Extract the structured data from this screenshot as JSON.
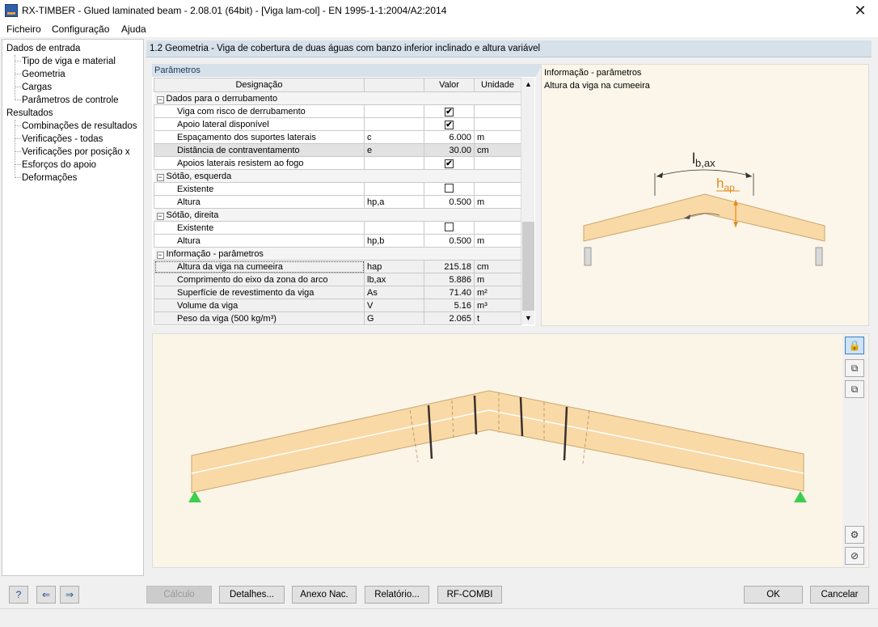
{
  "window": {
    "title": "RX-TIMBER - Glued laminated beam - 2.08.01 (64bit) - [Viga lam-col] - EN 1995-1-1:2004/A2:2014",
    "close_glyph": "✕"
  },
  "menu": [
    "Ficheiro",
    "Configuração",
    "Ajuda"
  ],
  "nav": {
    "group_input": "Dados de entrada",
    "input_items": [
      "Tipo de viga e material",
      "Geometria",
      "Cargas",
      "Parâmetros de controle"
    ],
    "group_results": "Resultados",
    "result_items": [
      "Combinações de resultados",
      "Verificações - todas",
      "Verificações por posição x",
      "Esforços do apoio",
      "Deformações"
    ]
  },
  "section": {
    "title": "1.2 Geometria  -  Viga de cobertura de duas águas com banzo inferior inclinado e altura variável"
  },
  "params": {
    "tab_label": "Parâmetros",
    "columns": [
      "Designação",
      "",
      "Valor",
      "Unidade"
    ],
    "groups": [
      {
        "label": "Dados para o derrubamento",
        "rows": [
          {
            "name": "Viga com risco de derrubamento",
            "sym": "",
            "value": "✔",
            "unit": "",
            "type": "check"
          },
          {
            "name": "Apoio lateral disponível",
            "sym": "",
            "value": "✔",
            "unit": "",
            "type": "check"
          },
          {
            "name": "Espaçamento dos suportes laterais",
            "sym": "c",
            "value": "6.000",
            "unit": "m",
            "type": "num"
          },
          {
            "name": "Distância de contraventamento",
            "sym": "e",
            "value": "30.00",
            "unit": "cm",
            "type": "num",
            "highlight": true
          },
          {
            "name": "Apoios laterais resistem ao fogo",
            "sym": "",
            "value": "✔",
            "unit": "",
            "type": "check"
          }
        ]
      },
      {
        "label": "Sótão, esquerda",
        "rows": [
          {
            "name": "Existente",
            "sym": "",
            "value": "",
            "unit": "",
            "type": "check"
          },
          {
            "name": "Altura",
            "sym": "hp,a",
            "value": "0.500",
            "unit": "m",
            "type": "num"
          }
        ]
      },
      {
        "label": "Sótão, direita",
        "rows": [
          {
            "name": "Existente",
            "sym": "",
            "value": "",
            "unit": "",
            "type": "check"
          },
          {
            "name": "Altura",
            "sym": "hp,b",
            "value": "0.500",
            "unit": "m",
            "type": "num"
          }
        ]
      },
      {
        "label": "Informação - parâmetros",
        "rows": [
          {
            "name": "Altura da viga na cumeeira",
            "sym": "hap",
            "value": "215.18",
            "unit": "cm",
            "type": "info",
            "focus": true
          },
          {
            "name": "Comprimento do eixo da zona do arco",
            "sym": "lb,ax",
            "value": "5.886",
            "unit": "m",
            "type": "info"
          },
          {
            "name": "Superfície de revestimento da viga",
            "sym": "As",
            "value": "71.40",
            "unit": "m²",
            "type": "info"
          },
          {
            "name": "Volume da viga",
            "sym": "V",
            "value": "5.16",
            "unit": "m³",
            "type": "info"
          },
          {
            "name": "Peso da viga (500 kg/m³)",
            "sym": "G",
            "value": "2.065",
            "unit": "t",
            "type": "info"
          }
        ]
      }
    ]
  },
  "info": {
    "header": "Informação - parâmetros",
    "subtitle": "Altura da viga na cumeeira",
    "label_lbax": "lb,ax",
    "label_hap": "hap",
    "accent": "#e58a1f"
  },
  "colors": {
    "beam_fill": "#f9d9a5",
    "beam_stroke": "#caa670",
    "support": "#3ccf4e"
  },
  "buttons": {
    "calc": "Cálculo",
    "details": "Detalhes...",
    "annex": "Anexo Nac.",
    "report": "Relatório...",
    "rfcombi": "RF-COMBI",
    "ok": "OK",
    "cancel": "Cancelar"
  }
}
